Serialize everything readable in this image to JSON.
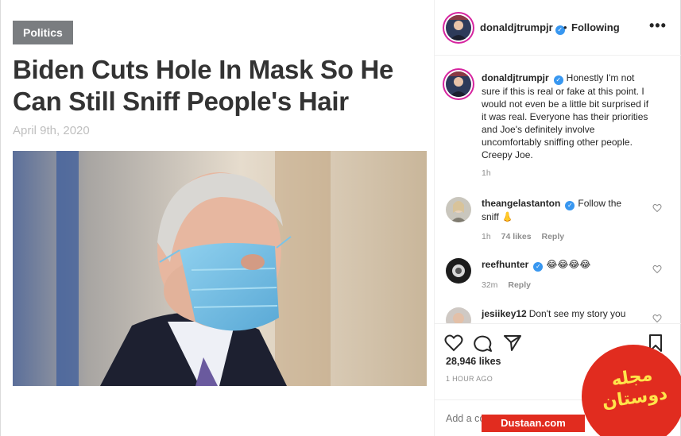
{
  "article": {
    "category": "Politics",
    "headline": "Biden Cuts Hole In Mask So He Can Still Sniff People's Hair",
    "date": "April 9th, 2020"
  },
  "post": {
    "author": "donaldjtrumpjr",
    "follow_status": "Following",
    "separator": "•",
    "more_icon": "more-options-icon",
    "caption_user": "donaldjtrumpjr",
    "caption": "Honestly I'm not sure if this is real or fake at this point. I would not even be a little bit surprised if it was real. Everyone has their priorities and Joe's definitely involve uncomfortably sniffing other people. Creepy Joe.",
    "caption_time": "1h",
    "likes": "28,946 likes",
    "time_ago": "1 HOUR AGO",
    "add_comment_placeholder": "Add a comment..."
  },
  "comments": [
    {
      "user": "theangelastanton",
      "verified": true,
      "text": "Follow the sniff 👃",
      "time": "1h",
      "likes": "74 likes",
      "reply": "Reply"
    },
    {
      "user": "reefhunter",
      "verified": true,
      "text": "😂😂😂😂",
      "time": "32m",
      "likes": "",
      "reply": "Reply"
    },
    {
      "user": "jesiikey12",
      "verified": false,
      "text": "Don't see my story you",
      "time": "",
      "likes": "",
      "reply": ""
    }
  ],
  "watermark": {
    "logo_text": "مجله دوستان",
    "site": "Dustaan.com"
  },
  "colors": {
    "category_bg": "#7a7d80",
    "headline": "#333333",
    "date": "#bfbfbf",
    "verified": "#3897f0",
    "muted": "#8e8e8e",
    "watermark_red": "#e12c1f",
    "watermark_yellow": "#ffe54b"
  }
}
